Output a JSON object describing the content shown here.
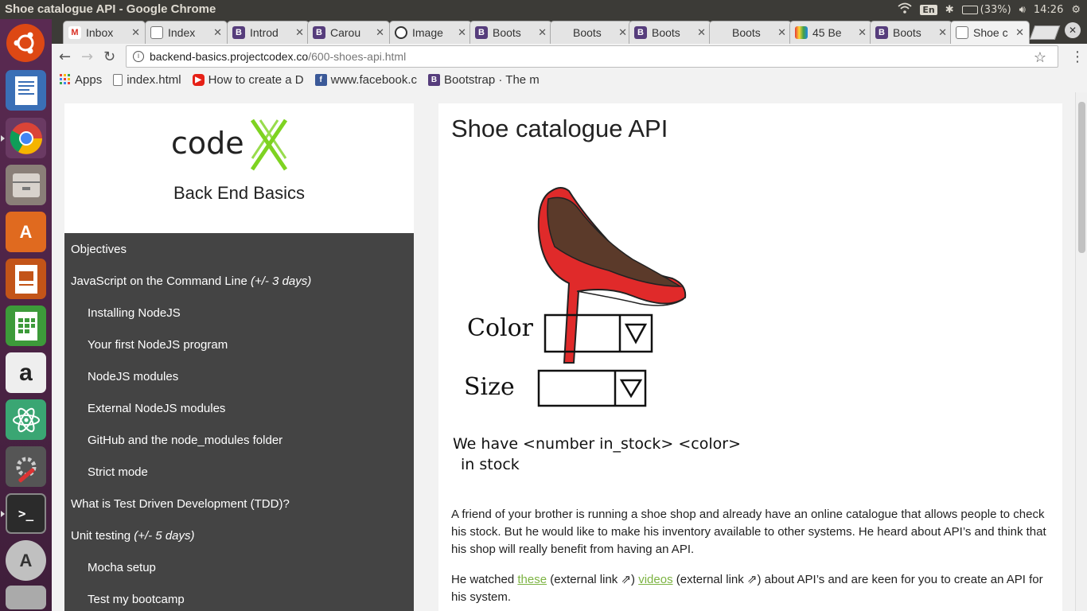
{
  "window": {
    "title": "Shoe catalogue API - Google Chrome"
  },
  "tray": {
    "lang": "En",
    "battery": "(33%)",
    "time": "14:26"
  },
  "tabs": [
    {
      "label": "Inbox",
      "icon": "gmail-icon",
      "color": "#d93025"
    },
    {
      "label": "Index",
      "icon": "doc-icon",
      "color": "#ffffff"
    },
    {
      "label": "Introd",
      "icon": "bootstrap-icon",
      "color": "#563d7c"
    },
    {
      "label": "Carou",
      "icon": "bootstrap-icon",
      "color": "#563d7c"
    },
    {
      "label": "Image",
      "icon": "image-icon",
      "color": "#333333"
    },
    {
      "label": "Boots",
      "icon": "bootstrap-icon",
      "color": "#563d7c"
    },
    {
      "label": "Boots",
      "icon": "blank-icon",
      "color": "#e4e4e4"
    },
    {
      "label": "Boots",
      "icon": "bootstrap-icon",
      "color": "#563d7c"
    },
    {
      "label": "Boots",
      "icon": "blank-icon",
      "color": "#e4e4e4"
    },
    {
      "label": "45 Be",
      "icon": "colorful-icon",
      "color": "#e53935"
    },
    {
      "label": "Boots",
      "icon": "bootstrap-icon",
      "color": "#563d7c"
    },
    {
      "label": "Shoe c",
      "icon": "doc-icon",
      "color": "#ffffff"
    }
  ],
  "address": {
    "host": "backend-basics.projectcodex.co",
    "path": "/600-shoes-api.html"
  },
  "bookmarks": [
    {
      "label": "Apps"
    },
    {
      "label": "index.html"
    },
    {
      "label": "How to create a D"
    },
    {
      "label": "www.facebook.c"
    },
    {
      "label": "Bootstrap · The m"
    }
  ],
  "sidebar": {
    "logo_text": "code",
    "course_title": "Back End Basics",
    "items": [
      {
        "label": "Objectives",
        "note": ""
      },
      {
        "label": "JavaScript on the Command Line",
        "note": "(+/- 3 days)"
      },
      {
        "label": "Installing NodeJS",
        "note": ""
      },
      {
        "label": "Your first NodeJS program",
        "note": ""
      },
      {
        "label": "NodeJS modules",
        "note": ""
      },
      {
        "label": "External NodeJS modules",
        "note": ""
      },
      {
        "label": "GitHub and the node_modules folder",
        "note": ""
      },
      {
        "label": "Strict mode",
        "note": ""
      },
      {
        "label": "What is Test Driven Development (TDD)?",
        "note": ""
      },
      {
        "label": "Unit testing",
        "note": "(+/- 5 days)"
      },
      {
        "label": "Mocha setup",
        "note": ""
      },
      {
        "label": "Test my bootcamp",
        "note": ""
      }
    ]
  },
  "content": {
    "title": "Shoe catalogue API",
    "sketch": {
      "color_label": "Color",
      "size_label": "Size",
      "stock_line1": "We have <number in_stock> <color>",
      "stock_line2": "in stock"
    },
    "para1": "A friend of your brother is running a shoe shop and already have an online catalogue that allows people to check his stock. But he would like to make his inventory available to other systems. He heard about API’s and think that his shop will really benefit from having an API.",
    "para2": {
      "before": "He watched ",
      "link1": "these",
      "ext1": " (external link ⇗) ",
      "link2": "videos",
      "ext2": " (external link ⇗) about API’s and are keen for you to create an API for his system."
    }
  }
}
